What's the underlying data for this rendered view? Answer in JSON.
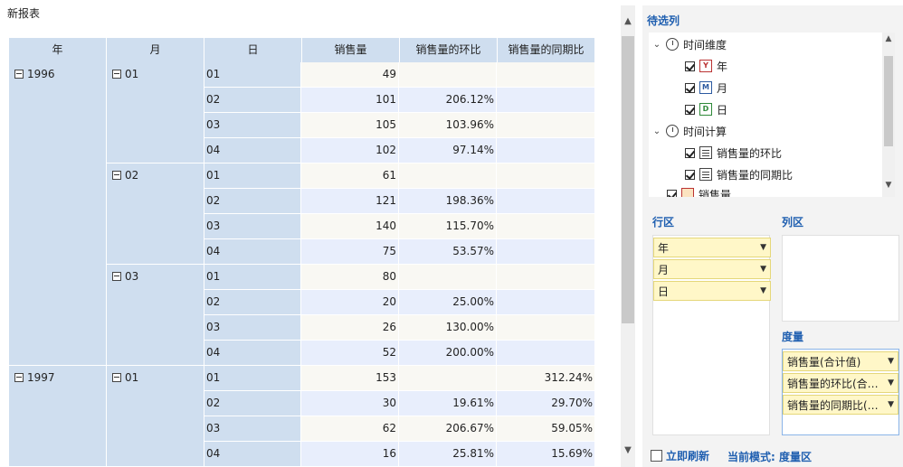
{
  "report": {
    "title": "新报表"
  },
  "table": {
    "headers": [
      "年",
      "月",
      "日",
      "销售量",
      "销售量的环比",
      "销售量的同期比"
    ],
    "years": [
      {
        "label": "1996",
        "rows": 12
      },
      {
        "label": "1997",
        "rows": 4
      }
    ],
    "months": [
      {
        "label": "01",
        "rows": 4
      },
      {
        "label": "02",
        "rows": 4
      },
      {
        "label": "03",
        "rows": 4
      },
      {
        "label": "01",
        "rows": 4
      }
    ],
    "rows": [
      [
        "01",
        "49",
        "",
        ""
      ],
      [
        "02",
        "101",
        "206.12%",
        ""
      ],
      [
        "03",
        "105",
        "103.96%",
        ""
      ],
      [
        "04",
        "102",
        "97.14%",
        ""
      ],
      [
        "01",
        "61",
        "",
        ""
      ],
      [
        "02",
        "121",
        "198.36%",
        ""
      ],
      [
        "03",
        "140",
        "115.70%",
        ""
      ],
      [
        "04",
        "75",
        "53.57%",
        ""
      ],
      [
        "01",
        "80",
        "",
        ""
      ],
      [
        "02",
        "20",
        "25.00%",
        ""
      ],
      [
        "03",
        "26",
        "130.00%",
        ""
      ],
      [
        "04",
        "52",
        "200.00%",
        ""
      ],
      [
        "01",
        "153",
        "",
        "312.24%"
      ],
      [
        "02",
        "30",
        "19.61%",
        "29.70%"
      ],
      [
        "03",
        "62",
        "206.67%",
        "59.05%"
      ],
      [
        "04",
        "16",
        "25.81%",
        "15.69%"
      ]
    ]
  },
  "panel": {
    "candidates_title": "待选列",
    "tree": {
      "time_dim": "时间维度",
      "year": "年",
      "month": "月",
      "day": "日",
      "time_calc": "时间计算",
      "mom": "销售量的环比",
      "yoy": "销售量的同期比",
      "measure_partial": "销售量"
    },
    "row_zone_title": "行区",
    "col_zone_title": "列区",
    "measure_zone_title": "度量",
    "row_chips": [
      "年",
      "月",
      "日"
    ],
    "measure_chips": [
      "销售量(合计值)",
      "销售量的环比(合…",
      "销售量的同期比(…"
    ],
    "refresh_label": "立即刷新",
    "mode_label": "当前模式: 度量区"
  },
  "colors": {
    "header_bg": "#cfdeef",
    "row_alt_a": "#f9f8f3",
    "row_alt_b": "#e8eefc",
    "accent": "#1f5fb0",
    "chip_bg": "#fff7c8"
  }
}
